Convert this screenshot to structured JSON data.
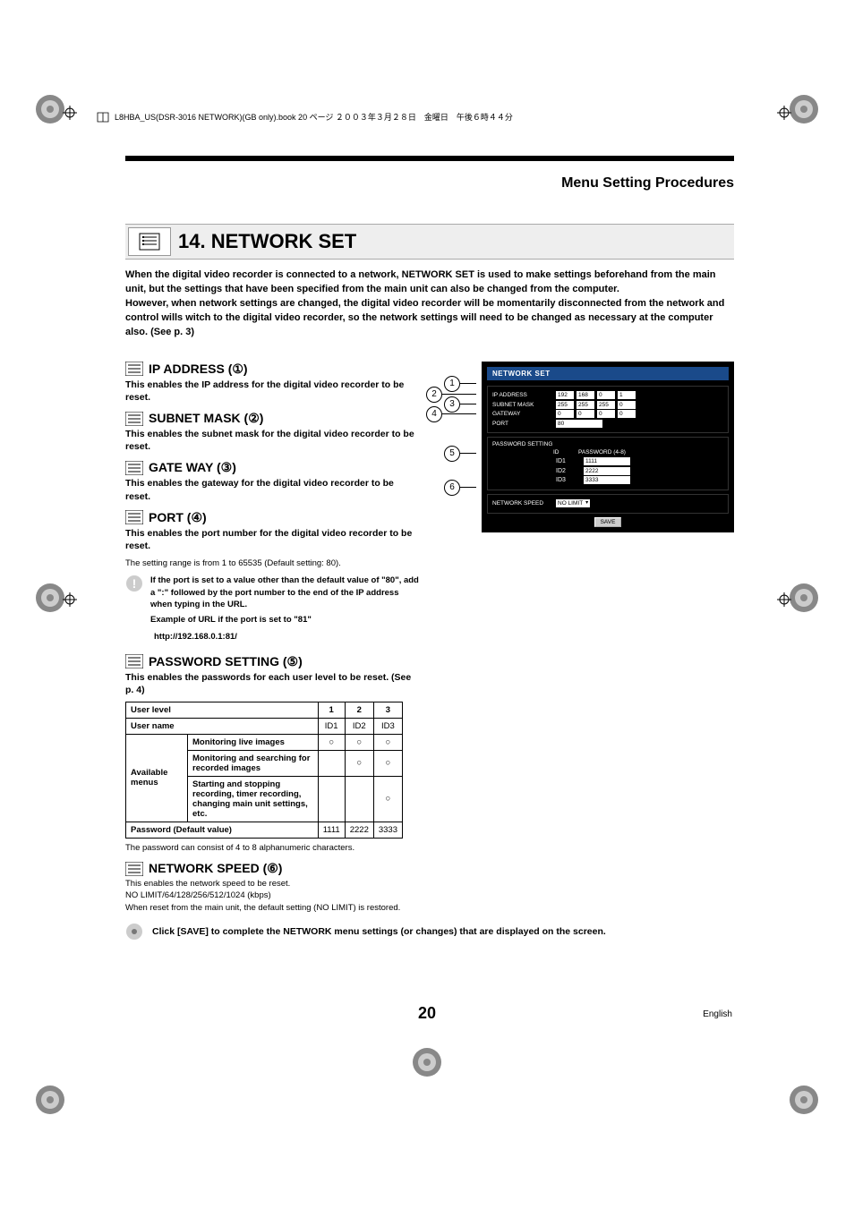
{
  "header_note": "L8HBA_US(DSR-3016 NETWORK)(GB only).book  20 ページ  ２００３年３月２８日　金曜日　午後６時４４分",
  "section_header": "Menu Setting Procedures",
  "chapter_title": "14.  NETWORK SET",
  "intro": "When the digital video recorder is connected to a network, NETWORK SET is used to make settings beforehand from the main unit, but the settings that have been specified from the main unit can also be changed from the computer.\nHowever, when network settings are changed, the digital video recorder will be momentarily disconnected from the network and control wills witch to the digital video recorder, so the network settings will need to be changed as necessary at the computer also. (See p. 3)",
  "sub": {
    "ip": {
      "title": "IP ADDRESS (①)",
      "desc": "This enables the IP address for the digital video recorder to be reset."
    },
    "subnet": {
      "title": "SUBNET MASK (②)",
      "desc": "This enables the subnet mask for the digital video recorder to be reset."
    },
    "gateway": {
      "title": "GATE WAY (③)",
      "desc": "This enables the gateway for the digital video recorder to be reset."
    },
    "port": {
      "title": "PORT (④)",
      "desc": "This enables the port number for the digital video recorder to be reset.",
      "range": "The setting range is from 1 to 65535 (Default setting: 80).",
      "warn": "If the port is set to a value other than the default value of \"80\", add a \":\" followed by the port number to the end of the IP address when typing in the URL.",
      "example_label": "Example of URL if the port is set to \"81\"",
      "example_url": "http://192.168.0.1:81/"
    },
    "password": {
      "title": "PASSWORD SETTING (⑤)",
      "desc": "This enables the passwords for each user level to be reset. (See p. 4)",
      "note": "The password can consist of 4 to 8 alphanumeric characters."
    },
    "speed": {
      "title": "NETWORK SPEED (⑥)",
      "l1": "This enables the network speed to be reset.",
      "l2": "NO LIMIT/64/128/256/512/1024 (kbps)",
      "l3": "When reset from the main unit, the default setting (NO LIMIT) is restored."
    }
  },
  "table": {
    "h_userlevel": "User level",
    "h_username": "User name",
    "h_available": "Available menus",
    "h_pwdefault": "Password (Default value)",
    "cols": [
      "1",
      "2",
      "3"
    ],
    "usernames": [
      "ID1",
      "ID2",
      "ID3"
    ],
    "rows": [
      {
        "label": "Monitoring live images",
        "vals": [
          "○",
          "○",
          "○"
        ]
      },
      {
        "label": "Monitoring and searching for recorded images",
        "vals": [
          "",
          "○",
          "○"
        ]
      },
      {
        "label": "Starting and stopping recording, timer recording, changing main unit settings, etc.",
        "vals": [
          "",
          "",
          "○"
        ]
      }
    ],
    "pwvals": [
      "1111",
      "2222",
      "3333"
    ]
  },
  "ui": {
    "title": "NETWORK SET",
    "ip_label": "IP ADDRESS",
    "ip": [
      "192",
      "168",
      "0",
      "1"
    ],
    "subnet_label": "SUBNET  MASK",
    "subnet": [
      "255",
      "255",
      "255",
      "0"
    ],
    "gateway_label": "GATEWAY",
    "gateway": [
      "0",
      "0",
      "0",
      "0"
    ],
    "port_label": "PORT",
    "port": "80",
    "pw_section": "PASSWORD SETTING",
    "pw_id": "ID",
    "pw_pw": "PASSWORD (4-8)",
    "ids": [
      "ID1",
      "ID2",
      "ID3"
    ],
    "pws": [
      "1111",
      "2222",
      "3333"
    ],
    "speed_label": "NETWORK SPEED",
    "speed_val": "NO LIMIT",
    "save": "SAVE"
  },
  "final_note": "Click [SAVE] to complete the NETWORK menu settings (or changes) that are displayed on the screen.",
  "page_number": "20",
  "language": "English",
  "callouts": [
    "1",
    "2",
    "3",
    "4",
    "5",
    "6"
  ]
}
